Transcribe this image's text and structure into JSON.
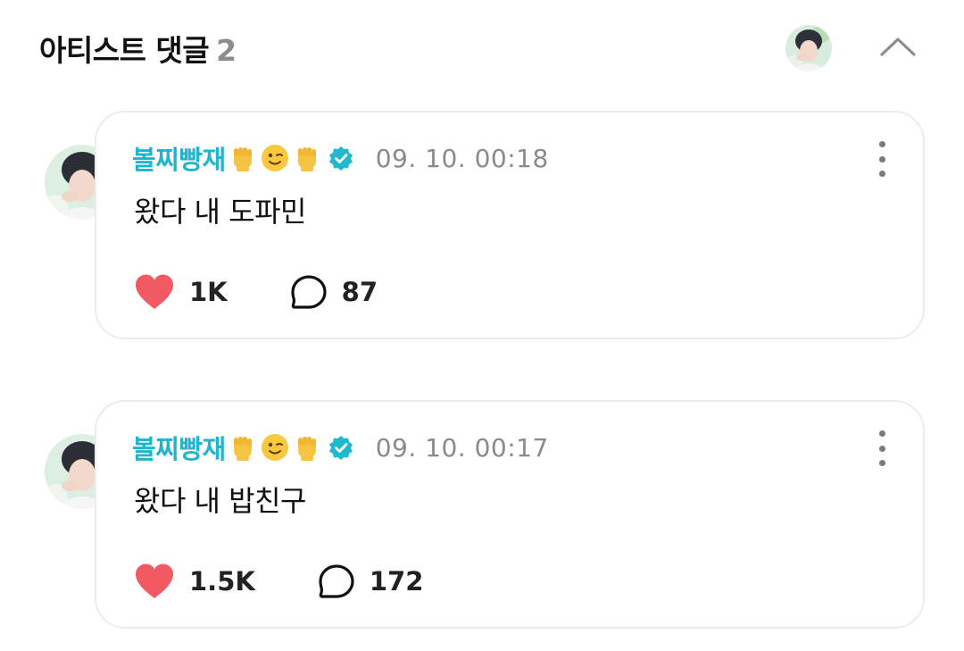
{
  "header": {
    "title": "아티스트 댓글",
    "count": "2"
  },
  "comments": [
    {
      "author": "볼찌빵재",
      "timestamp": "09. 10. 00:18",
      "text": "왔다 내 도파민",
      "likes": "1K",
      "replies": "87"
    },
    {
      "author": "볼찌빵재",
      "timestamp": "09. 10. 00:17",
      "text": "왔다 내 밥친구",
      "likes": "1.5K",
      "replies": "172"
    }
  ],
  "icons": {
    "collapse": "chevron-up-icon",
    "like": "heart-icon",
    "reply": "speech-bubble-icon",
    "verified": "verified-badge-icon",
    "more": "kebab-menu-icon",
    "author_emojis": [
      "raised-fist-emoji",
      "winking-face-emoji",
      "raised-fist-emoji"
    ]
  },
  "colors": {
    "author": "#20b5ce",
    "like": "#f25a63",
    "verified": "#1fb8cd",
    "timestamp": "#8a8a8a",
    "count_muted": "#8c8c8c"
  }
}
